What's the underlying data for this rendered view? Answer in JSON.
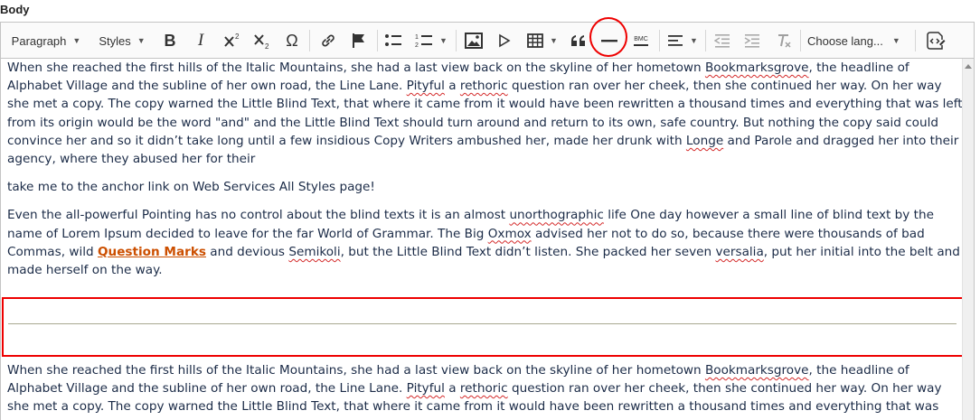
{
  "field_label": "Body",
  "toolbar": {
    "paragraph_label": "Paragraph",
    "styles_label": "Styles",
    "bold_label": "B",
    "italic_label": "I",
    "special_char_label": "Ω",
    "language_label": "Choose lang...",
    "bmc_label": "BMC"
  },
  "content": {
    "p1": {
      "a": "When she reached the first hills of the Italic Mountains, she had a last view back on the skyline of her hometown ",
      "w1": "Bookmarksgrove",
      "b": ", the headline of Alphabet Village and the subline of her own road, the Line Lane. ",
      "w2": "Pityful",
      "c": " a ",
      "w3": "rethoric",
      "d": " question ran over her cheek, then she continued her way. On her way she met a copy. The copy warned the Little Blind Text, that where it came from it would have been rewritten a thousand times and everything that was left from its origin would be the word \"and\" and the Little Blind Text should turn around and return to its own, safe country. But nothing the copy said could convince her and so it didn’t take long until a few insidious Copy Writers ambushed her, made her drunk with ",
      "w4": "Longe",
      "e": " and Parole and dragged her into their agency, where they abused her for their"
    },
    "p2": "take me to the anchor link on Web Services All Styles page!",
    "p3": {
      "a": "Even the all-powerful Pointing has no control about the blind texts it is an almost ",
      "w1": "unorthographic",
      "b": " life One day however a small line of blind text by the name of Lorem Ipsum decided to leave for the far World of Grammar. The Big ",
      "w2": "Oxmox",
      "c": " advised her not to do so, because there were thousands of bad Commas, wild ",
      "link": "Question Marks",
      "d": " and devious ",
      "w3": "Semikoli",
      "e": ", but the Little Blind Text didn’t listen. She packed her seven ",
      "w4": "versalia",
      "f": ", put her initial into the belt and made herself on the way."
    },
    "p4": {
      "a": "When she reached the first hills of the Italic Mountains, she had a last view back on the skyline of her hometown ",
      "w1": "Bookmarksgrove",
      "b": ", the headline of Alphabet Village and the subline of her own road, the Line Lane. ",
      "w2": "Pityful",
      "c": " a ",
      "w3": "rethoric",
      "d": " question ran over her cheek, then she continued her way. On her way she met a copy. The copy warned the Little Blind Text, that where it came from it would have been rewritten a thousand times and everything that was left from its origin would be the word \"and\" and the Little Blind Text should turn around and return to its own, safe country."
    }
  },
  "colors": {
    "highlight_red": "#ee0000",
    "link_orange": "#cc4f00",
    "text": "#1b2b47"
  }
}
